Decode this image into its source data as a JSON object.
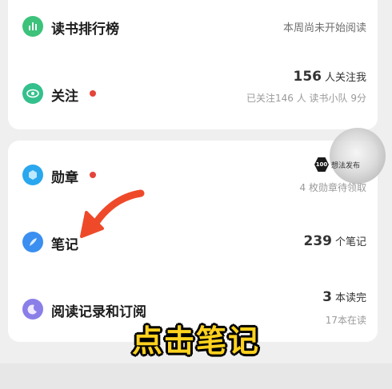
{
  "card1": {
    "rank": {
      "title": "读书排行榜",
      "status": "本周尚未开始阅读"
    },
    "follow": {
      "title": "关注",
      "count": "156",
      "count_unit": "人关注我",
      "sub": "已关注146 人 读书小队 9分"
    }
  },
  "card2": {
    "badge": {
      "title": "勋章",
      "sub": "4 枚勋章待领取"
    },
    "notes": {
      "title": "笔记",
      "count": "239",
      "count_unit": "个笔记"
    },
    "reading": {
      "title": "阅读记录和订阅",
      "count": "3",
      "count_unit": "本读完",
      "sub": "17本在读"
    }
  },
  "toast": {
    "badge": "100",
    "text": "想法发布"
  },
  "caption": "点击笔记",
  "colors": {
    "rank_icon": "#3cc27a",
    "follow_icon": "#34c08d",
    "badge_icon": "#2aa7ee",
    "notes_icon": "#3a8ff0",
    "reading_icon": "#8a7ee8",
    "red_dot": "#e4453a",
    "arrow": "#ee4a2a",
    "caption": "#ffd21e"
  }
}
